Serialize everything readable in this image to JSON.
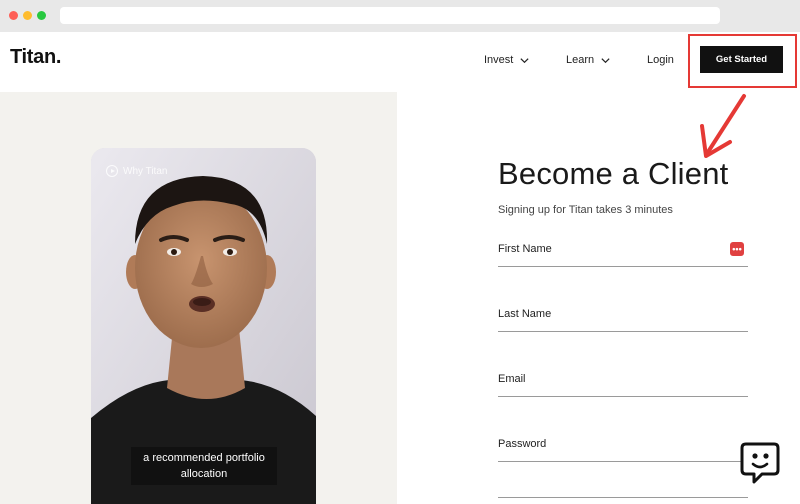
{
  "browser": {
    "url": ""
  },
  "header": {
    "logo": "Titan.",
    "nav": [
      {
        "label": "Invest"
      },
      {
        "label": "Learn"
      },
      {
        "label": "Login"
      }
    ],
    "cta_label": "Get Started",
    "annotation_color": "#e53935"
  },
  "video": {
    "badge": "Why Titan",
    "caption": "a recommended portfolio allocation"
  },
  "form": {
    "heading": "Become a Client",
    "subheading": "Signing up for Titan takes 3 minutes",
    "fields": [
      {
        "label": "First Name"
      },
      {
        "label": "Last Name"
      },
      {
        "label": "Email"
      },
      {
        "label": "Password"
      }
    ],
    "autofill_icon": "•••"
  },
  "colors": {
    "accent": "#111111",
    "panel_bg": "#f3f2ee",
    "annotation": "#e53935"
  }
}
